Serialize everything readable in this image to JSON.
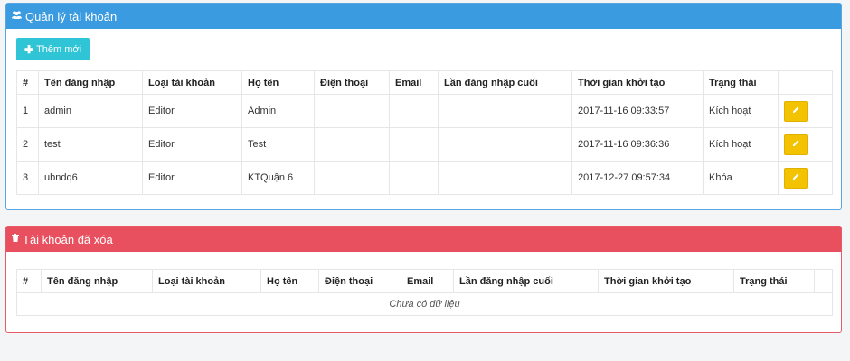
{
  "accounts_panel": {
    "title": "Quản lý tài khoản",
    "title_icon": "users-icon",
    "add_button_label": "Thêm mới",
    "columns": [
      "#",
      "Tên đăng nhập",
      "Loại tài khoản",
      "Họ tên",
      "Điện thoại",
      "Email",
      "Lần đăng nhập cuối",
      "Thời gian khởi tạo",
      "Trạng thái",
      ""
    ],
    "rows": [
      {
        "index": "1",
        "username": "admin",
        "type": "Editor",
        "fullname": "Admin",
        "phone": "",
        "email": "",
        "last_login": "",
        "created": "2017-11-16 09:33:57",
        "status": "Kích hoạt"
      },
      {
        "index": "2",
        "username": "test",
        "type": "Editor",
        "fullname": "Test",
        "phone": "",
        "email": "",
        "last_login": "",
        "created": "2017-11-16 09:36:36",
        "status": "Kích hoạt"
      },
      {
        "index": "3",
        "username": "ubndq6",
        "type": "Editor",
        "fullname": "KTQuận 6",
        "phone": "",
        "email": "",
        "last_login": "",
        "created": "2017-12-27 09:57:34",
        "status": "Khóa"
      }
    ],
    "edit_icon": "pencil-icon",
    "heading_color": "#3a9be0"
  },
  "deleted_panel": {
    "title": "Tài khoản đã xóa",
    "title_icon": "trash-icon",
    "columns": [
      "#",
      "Tên đăng nhập",
      "Loại tài khoản",
      "Họ tên",
      "Điện thoại",
      "Email",
      "Lần đăng nhập cuối",
      "Thời gian khởi tạo",
      "Trạng thái"
    ],
    "empty_text": "Chưa có dữ liệu",
    "heading_color": "#e8505f"
  },
  "colors": {
    "add_button": "#2fc5d6",
    "edit_button": "#f3c200"
  }
}
